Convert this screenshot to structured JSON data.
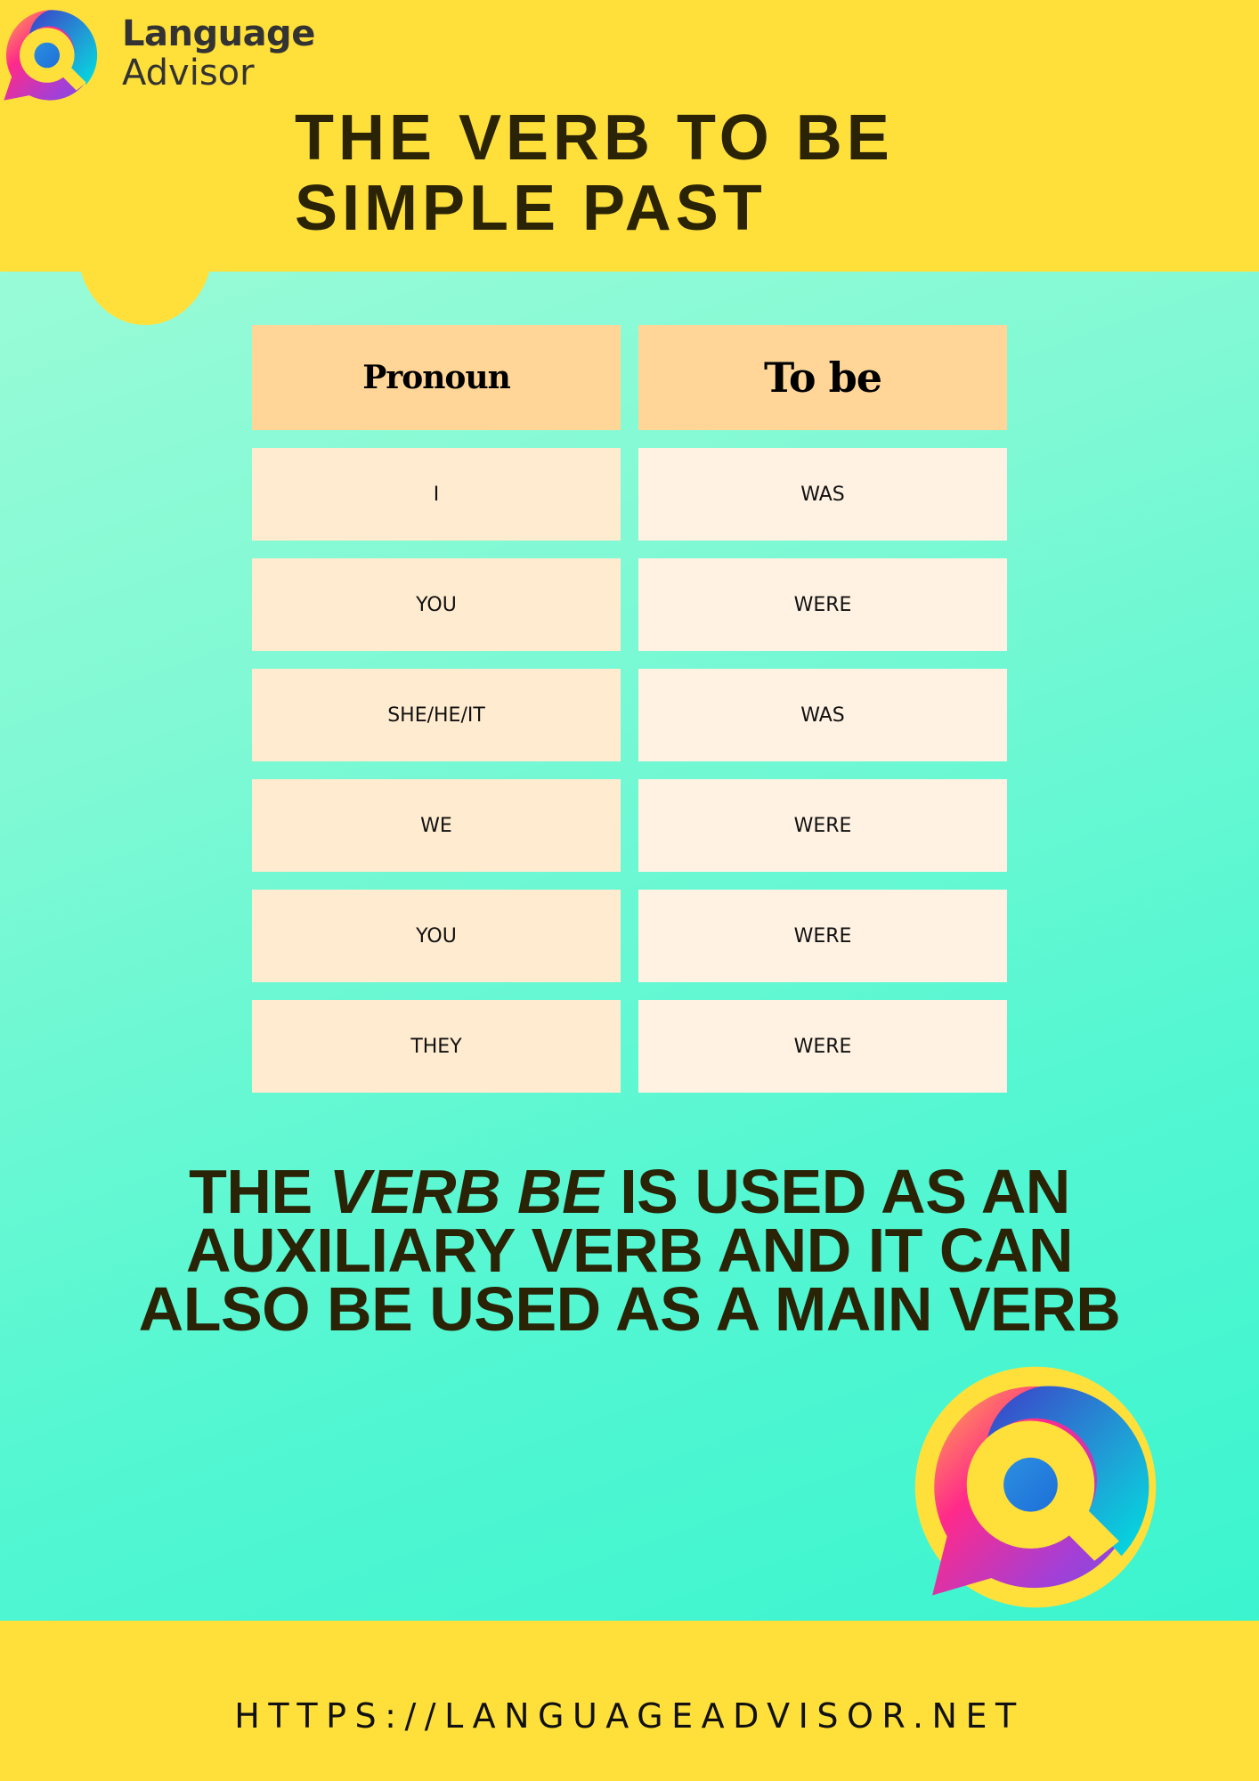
{
  "brand": {
    "name_line1": "Language",
    "name_line2": "Advisor",
    "logo_icon": "speech-bubble-search-icon"
  },
  "title": {
    "line1": "THE VERB TO BE",
    "line2": "SIMPLE PAST"
  },
  "table": {
    "headers": [
      "Pronoun",
      "To be"
    ],
    "rows": [
      [
        "I",
        "WAS"
      ],
      [
        "YOU",
        "WERE"
      ],
      [
        "SHE/HE/IT",
        "WAS"
      ],
      [
        "WE",
        "WERE"
      ],
      [
        "YOU",
        "WERE"
      ],
      [
        "THEY",
        "WERE"
      ]
    ]
  },
  "statement": {
    "line1_pre": "THE ",
    "line1_em": "VERB BE",
    "line1_post": " IS USED AS AN",
    "line2": "AUXILIARY VERB AND IT CAN",
    "line3": "ALSO BE USED AS A MAIN VERB"
  },
  "footer": {
    "url": "HTTPS://LANGUAGEADVISOR.NET"
  },
  "colors": {
    "yellow": "#ffe03b",
    "header_cell": "#ffd697",
    "pronoun_cell": "#ffebcf",
    "verb_cell": "#fff2e2",
    "text_dark": "#2a2306",
    "bg_top": "#a6fcd9",
    "bg_bottom": "#34f4ce"
  }
}
